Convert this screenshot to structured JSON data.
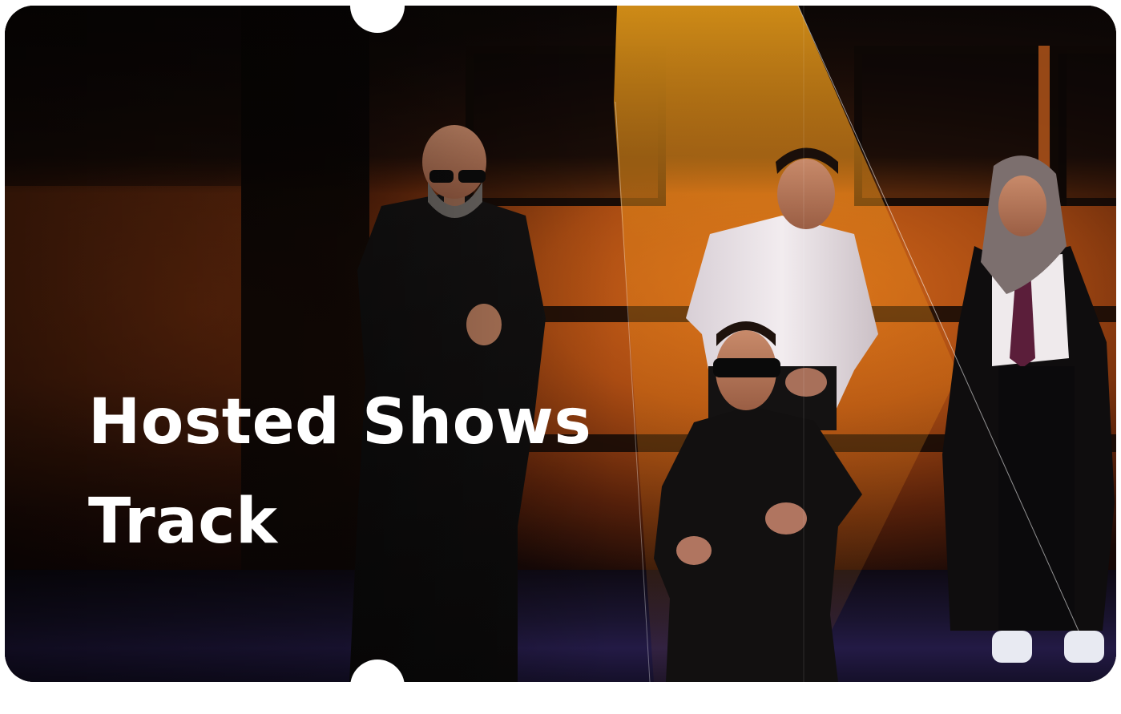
{
  "card": {
    "title_line_1": "Hosted Shows",
    "title_line_2": "Track"
  },
  "colors": {
    "accent_spotlight": "#f0a21a",
    "stage_orange": "#d86a1c",
    "title_text": "#ffffff"
  }
}
